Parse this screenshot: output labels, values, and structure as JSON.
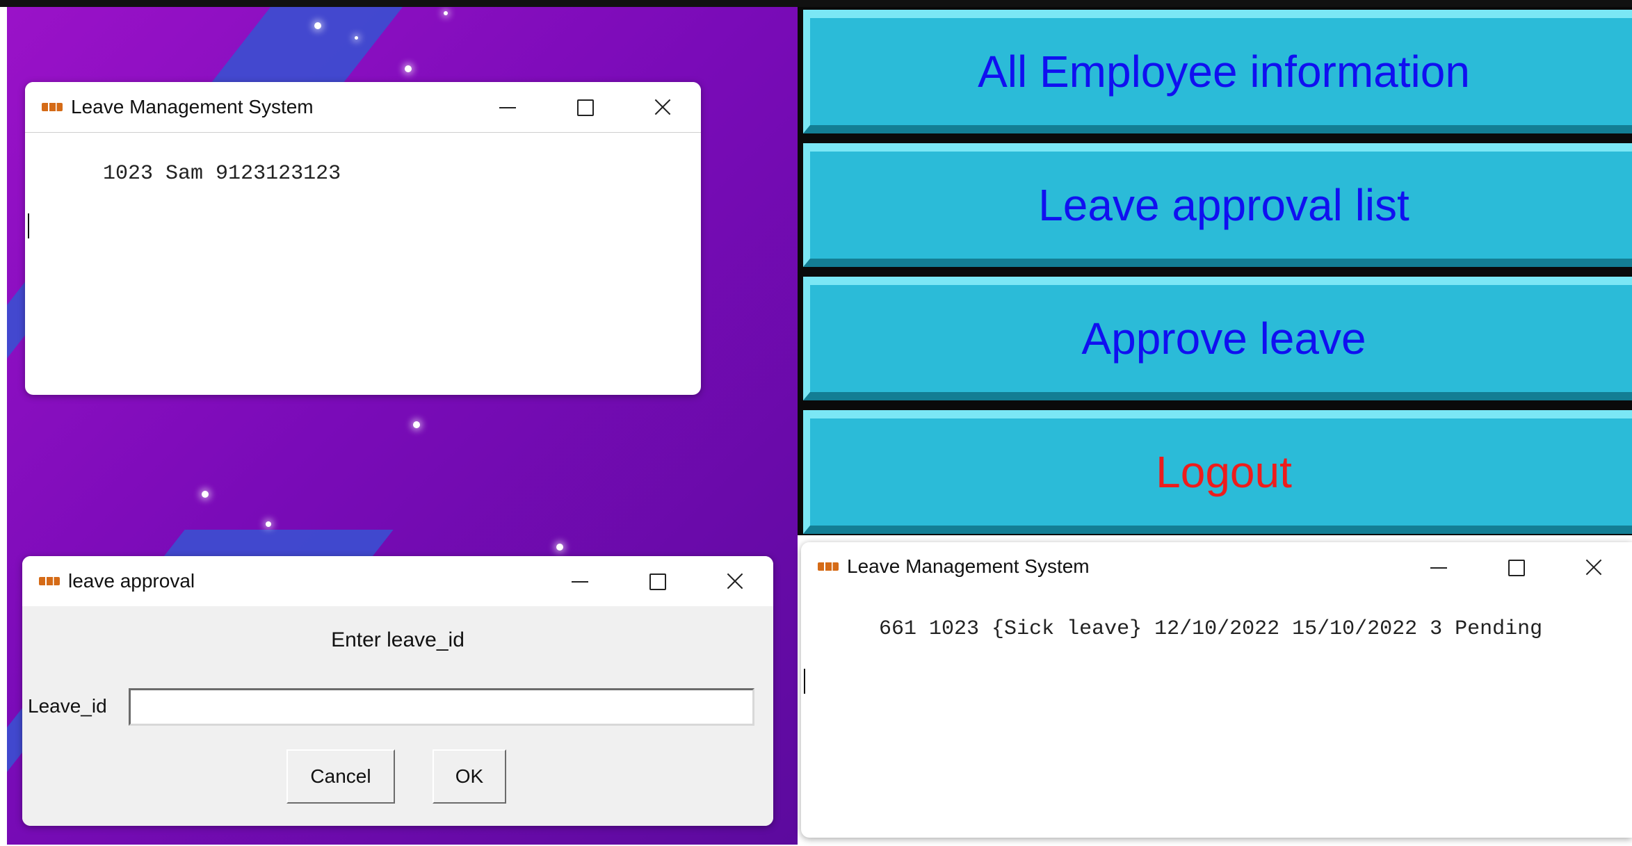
{
  "windows": {
    "employee_info": {
      "title": "Leave Management System",
      "content": "1023 Sam 9123123123"
    },
    "leave_approval_dialog": {
      "title": "leave approval",
      "prompt": "Enter leave_id",
      "field_label": "Leave_id",
      "field_value": "",
      "cancel_label": "Cancel",
      "ok_label": "OK"
    },
    "leave_list": {
      "title": "Leave Management System",
      "content": "661 1023 {Sick leave} 12/10/2022 15/10/2022 3 Pending"
    }
  },
  "menu": {
    "items": [
      {
        "label": "All Employee information"
      },
      {
        "label": "Leave approval list"
      },
      {
        "label": "Approve leave"
      },
      {
        "label": "Logout"
      }
    ]
  },
  "colors": {
    "menu_button_bg": "#2bbbd8",
    "menu_text": "#1010f0",
    "logout_text": "#ee1c1c",
    "wallpaper": "#8a10c0"
  }
}
